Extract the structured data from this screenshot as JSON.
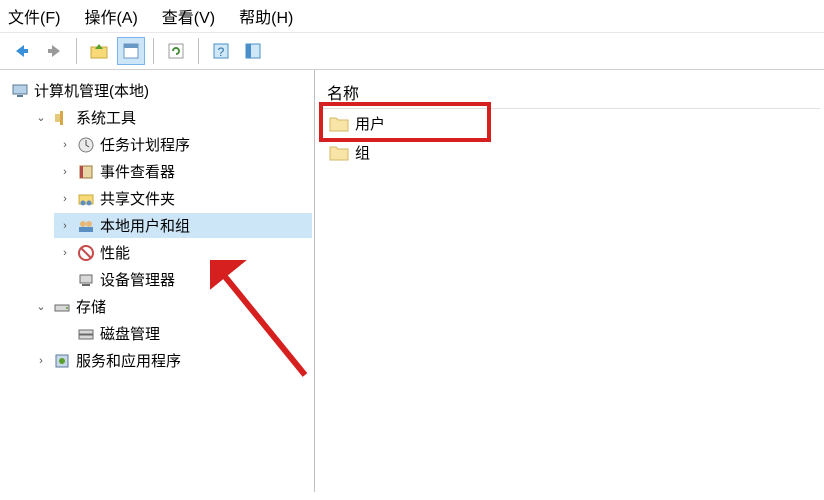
{
  "menu": {
    "file": "文件(F)",
    "action": "操作(A)",
    "view": "查看(V)",
    "help": "帮助(H)"
  },
  "toolbar": {
    "back": "back",
    "forward": "forward",
    "up": "up",
    "props": "properties",
    "refresh": "refresh",
    "help": "help",
    "showhide": "show-hide"
  },
  "tree": {
    "root": "计算机管理(本地)",
    "systemTools": "系统工具",
    "taskScheduler": "任务计划程序",
    "eventViewer": "事件查看器",
    "sharedFolders": "共享文件夹",
    "localUsersGroups": "本地用户和组",
    "performance": "性能",
    "deviceManager": "设备管理器",
    "storage": "存储",
    "diskManagement": "磁盘管理",
    "servicesApps": "服务和应用程序"
  },
  "list": {
    "columnName": "名称",
    "users": "用户",
    "groups": "组"
  }
}
